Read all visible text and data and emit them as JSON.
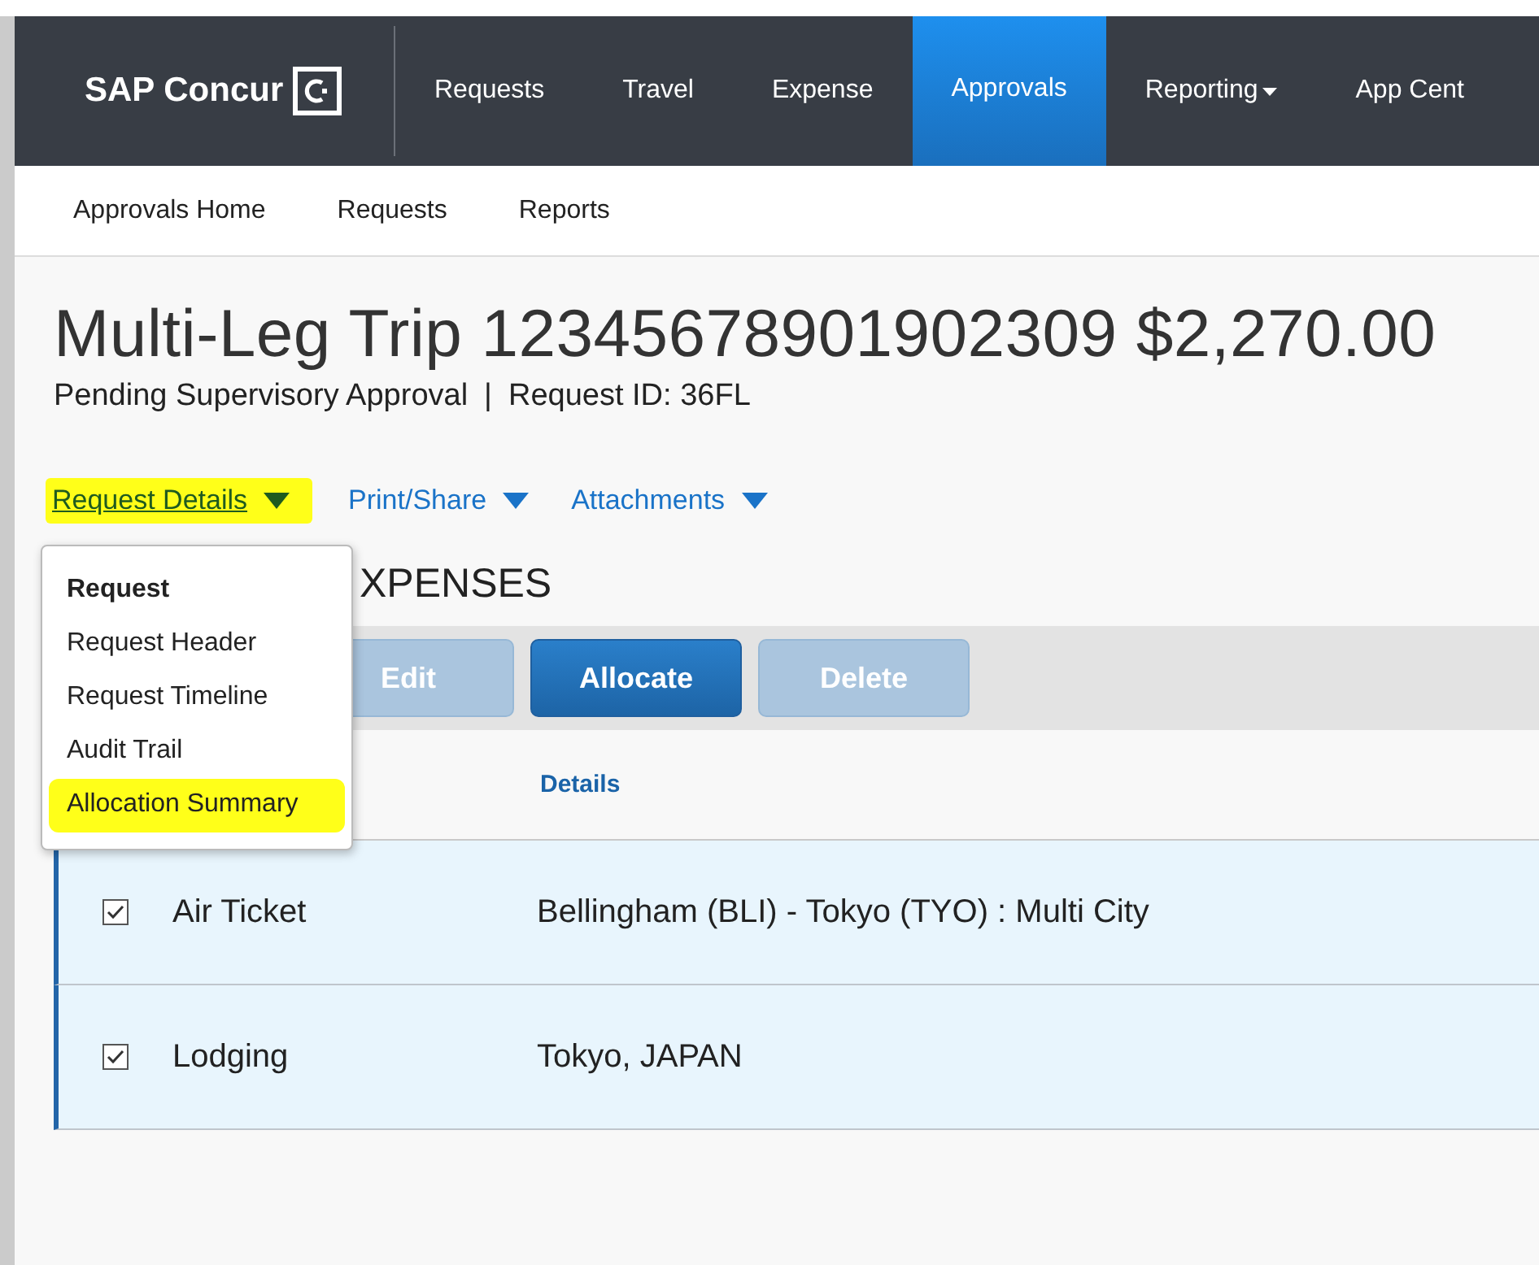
{
  "nav": {
    "logo": "SAP Concur",
    "items": [
      {
        "label": "Requests",
        "selected": false,
        "dropdown": false
      },
      {
        "label": "Travel",
        "selected": false,
        "dropdown": false
      },
      {
        "label": "Expense",
        "selected": false,
        "dropdown": false
      },
      {
        "label": "Approvals",
        "selected": true,
        "dropdown": false
      },
      {
        "label": "Reporting",
        "selected": false,
        "dropdown": true
      },
      {
        "label": "App Cent",
        "selected": false,
        "dropdown": false
      }
    ]
  },
  "subnav": [
    "Approvals Home",
    "Requests",
    "Reports"
  ],
  "title": "Multi-Leg Trip 12345678901902309 $2,270.00",
  "subtitle": {
    "status": "Pending Supervisory Approval",
    "separator": "|",
    "request_id": "Request ID: 36FL"
  },
  "actions": [
    {
      "label": "Request Details",
      "highlighted": true,
      "expanded": true
    },
    {
      "label": "Print/Share",
      "highlighted": false,
      "expanded": false
    },
    {
      "label": "Attachments",
      "highlighted": false,
      "expanded": false
    }
  ],
  "menu": {
    "heading": "Request",
    "items": [
      {
        "label": "Request Header",
        "highlighted": false
      },
      {
        "label": "Request Timeline",
        "highlighted": false
      },
      {
        "label": "Audit Trail",
        "highlighted": false
      },
      {
        "label": "Allocation Summary",
        "highlighted": true
      }
    ]
  },
  "section_heading": "XPENSES",
  "buttons": [
    {
      "label": "Edit",
      "disabled": true
    },
    {
      "label": "Allocate",
      "disabled": false
    },
    {
      "label": "Delete",
      "disabled": true
    }
  ],
  "table": {
    "columns": [
      "Details"
    ],
    "rows": [
      {
        "checked": true,
        "type": "Air Ticket",
        "details": "Bellingham (BLI) - Tokyo (TYO) : Multi City"
      },
      {
        "checked": true,
        "type": "Lodging",
        "details": "Tokyo, JAPAN"
      }
    ]
  }
}
